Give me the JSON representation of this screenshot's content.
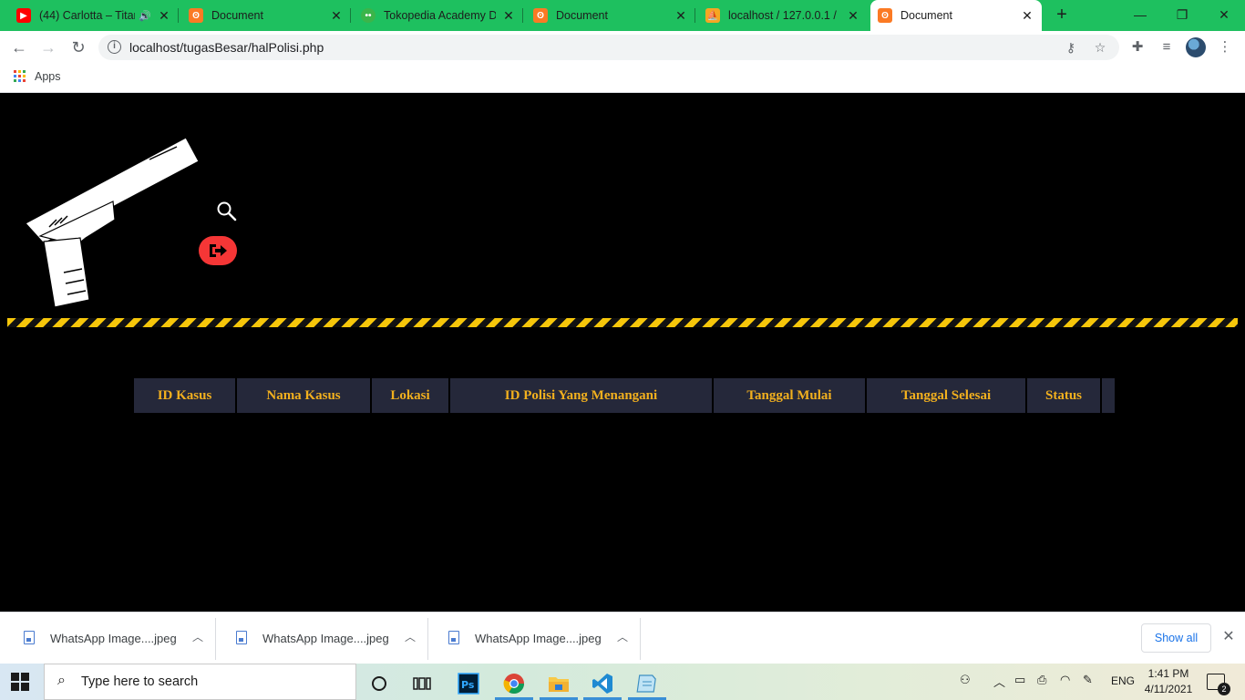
{
  "browser": {
    "tabs": [
      {
        "title": "(44) Carlotta – Titan",
        "favicon": "youtube-icon",
        "audio": true
      },
      {
        "title": "Document",
        "favicon": "xampp-icon"
      },
      {
        "title": "Tokopedia Academy De",
        "favicon": "tokopedia-icon"
      },
      {
        "title": "Document",
        "favicon": "xampp-icon"
      },
      {
        "title": "localhost / 127.0.0.1 / k",
        "favicon": "phpmyadmin-icon"
      },
      {
        "title": "Document",
        "favicon": "xampp-icon",
        "active": true
      }
    ],
    "address": "localhost/tugasBesar/halPolisi.php",
    "bookmarks": {
      "apps_label": "Apps"
    }
  },
  "page": {
    "table": {
      "headers": [
        "ID Kasus",
        "Nama Kasus",
        "Lokasi",
        "ID Polisi Yang Menangani",
        "Tanggal Mulai",
        "Tanggal Selesai",
        "Status",
        ""
      ]
    },
    "colors": {
      "accent": "#f2b01e",
      "header_bg": "#25283a",
      "logout": "#f53636",
      "tape": "#f6c60a"
    }
  },
  "downloads": {
    "items": [
      {
        "name": "WhatsApp Image....jpeg"
      },
      {
        "name": "WhatsApp Image....jpeg"
      },
      {
        "name": "WhatsApp Image....jpeg"
      }
    ],
    "show_all": "Show all"
  },
  "taskbar": {
    "search_placeholder": "Type here to search",
    "language": "ENG",
    "time": "1:41 PM",
    "date": "4/11/2021",
    "notifications": "2"
  }
}
